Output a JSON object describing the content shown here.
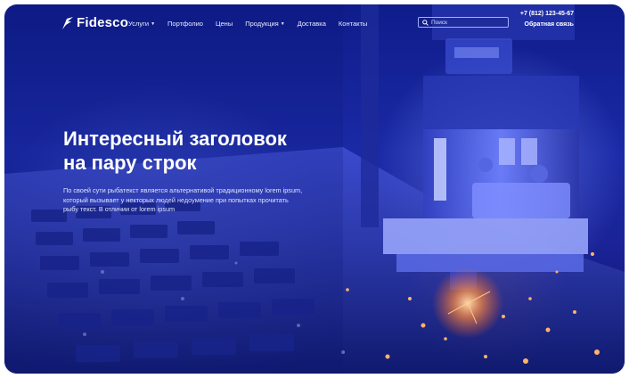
{
  "brand": {
    "name": "Fidesco"
  },
  "nav": {
    "items": [
      {
        "label": "Услуги",
        "has_dropdown": true
      },
      {
        "label": "Портфолио",
        "has_dropdown": false
      },
      {
        "label": "Цены",
        "has_dropdown": false
      },
      {
        "label": "Продукция",
        "has_dropdown": true
      },
      {
        "label": "Доставка",
        "has_dropdown": false
      },
      {
        "label": "Контакты",
        "has_dropdown": false
      }
    ]
  },
  "search": {
    "placeholder": "Поиск",
    "icon": "search-icon"
  },
  "contact": {
    "phone": "+7 (812) 123-45-67",
    "callback_label": "Обратная связь"
  },
  "hero": {
    "title_line1": "Интересный заголовок",
    "title_line2": "на пару строк",
    "text": "По своей сути рыбатекст является альтернативой традиционному lorem ipsum, который вызывает у некторых людей недоумение при попытках прочитать рыбу текст. В отличии от lorem ipsum"
  },
  "colors": {
    "background_primary": "#1a2aa6",
    "background_dark": "#0b1260",
    "text": "#ffffff",
    "sparks": "#ff8a3d"
  }
}
